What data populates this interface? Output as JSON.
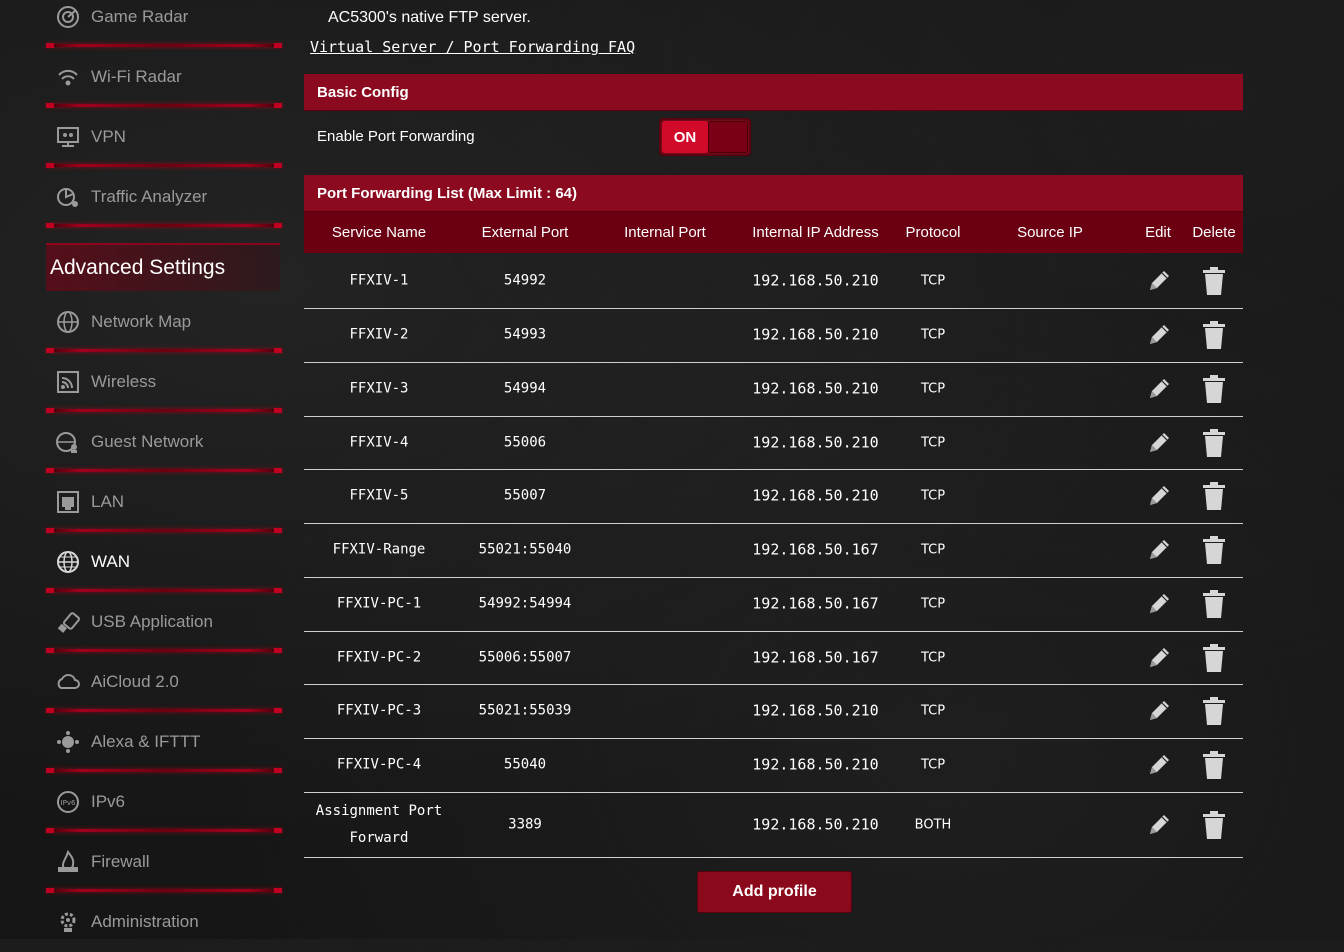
{
  "sidebar": {
    "items_top": [
      {
        "label": "Game Radar",
        "icon": "game-radar-icon"
      },
      {
        "label": "Wi-Fi Radar",
        "icon": "wifi-radar-icon"
      },
      {
        "label": "VPN",
        "icon": "vpn-icon"
      },
      {
        "label": "Traffic Analyzer",
        "icon": "traffic-analyzer-icon"
      }
    ],
    "advanced_header": "Advanced Settings",
    "items_adv": [
      {
        "label": "Network Map",
        "icon": "network-map-icon"
      },
      {
        "label": "Wireless",
        "icon": "wireless-icon"
      },
      {
        "label": "Guest Network",
        "icon": "guest-network-icon"
      },
      {
        "label": "LAN",
        "icon": "lan-icon"
      },
      {
        "label": "WAN",
        "icon": "wan-icon",
        "active": true
      },
      {
        "label": "USB Application",
        "icon": "usb-icon"
      },
      {
        "label": "AiCloud 2.0",
        "icon": "aicloud-icon"
      },
      {
        "label": "Alexa & IFTTT",
        "icon": "alexa-icon"
      },
      {
        "label": "IPv6",
        "icon": "ipv6-icon"
      },
      {
        "label": "Firewall",
        "icon": "firewall-icon"
      },
      {
        "label": "Administration",
        "icon": "administration-icon"
      }
    ]
  },
  "main": {
    "intro_text": "AC5300's native FTP server.",
    "faq_link": "Virtual Server / Port Forwarding FAQ",
    "basic_config": {
      "title": "Basic Config",
      "enable_label": "Enable Port Forwarding",
      "toggle_state": "ON"
    },
    "list": {
      "title": "Port Forwarding List (Max Limit : 64)",
      "headers": [
        "Service Name",
        "External Port",
        "Internal Port",
        "Internal IP Address",
        "Protocol",
        "Source IP",
        "Edit",
        "Delete"
      ],
      "rows": [
        {
          "service": "FFXIV-1",
          "external": "54992",
          "internal": "",
          "ip": "192.168.50.210",
          "protocol": "TCP",
          "source": ""
        },
        {
          "service": "FFXIV-2",
          "external": "54993",
          "internal": "",
          "ip": "192.168.50.210",
          "protocol": "TCP",
          "source": ""
        },
        {
          "service": "FFXIV-3",
          "external": "54994",
          "internal": "",
          "ip": "192.168.50.210",
          "protocol": "TCP",
          "source": ""
        },
        {
          "service": "FFXIV-4",
          "external": "55006",
          "internal": "",
          "ip": "192.168.50.210",
          "protocol": "TCP",
          "source": ""
        },
        {
          "service": "FFXIV-5",
          "external": "55007",
          "internal": "",
          "ip": "192.168.50.210",
          "protocol": "TCP",
          "source": ""
        },
        {
          "service": "FFXIV-Range",
          "external": "55021:55040",
          "internal": "",
          "ip": "192.168.50.167",
          "protocol": "TCP",
          "source": ""
        },
        {
          "service": "FFXIV-PC-1",
          "external": "54992:54994",
          "internal": "",
          "ip": "192.168.50.167",
          "protocol": "TCP",
          "source": ""
        },
        {
          "service": "FFXIV-PC-2",
          "external": "55006:55007",
          "internal": "",
          "ip": "192.168.50.167",
          "protocol": "TCP",
          "source": ""
        },
        {
          "service": "FFXIV-PC-3",
          "external": "55021:55039",
          "internal": "",
          "ip": "192.168.50.210",
          "protocol": "TCP",
          "source": ""
        },
        {
          "service": "FFXIV-PC-4",
          "external": "55040",
          "internal": "",
          "ip": "192.168.50.210",
          "protocol": "TCP",
          "source": ""
        },
        {
          "service": "Assignment Port\nForward",
          "external": "3389",
          "internal": "",
          "ip": "192.168.50.210",
          "protocol": "BOTH",
          "source": ""
        }
      ]
    },
    "add_button": "Add profile"
  },
  "colors": {
    "accent": "#8c0a1f",
    "header_dark": "#6a0012",
    "toggle_on": "#d10a2a"
  }
}
